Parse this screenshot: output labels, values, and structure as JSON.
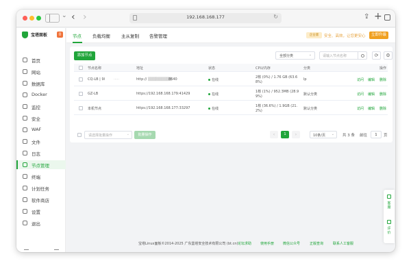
{
  "browser": {
    "url": "192.168.168.177"
  },
  "sidebar": {
    "brand": "宝塔面板",
    "badge": "0",
    "items": [
      {
        "label": "首页",
        "icon": "home-icon"
      },
      {
        "label": "网站",
        "icon": "globe-icon"
      },
      {
        "label": "数据库",
        "icon": "database-icon"
      },
      {
        "label": "Docker",
        "icon": "docker-icon"
      },
      {
        "label": "监控",
        "icon": "monitor-icon"
      },
      {
        "label": "安全",
        "icon": "shield-icon"
      },
      {
        "label": "WAF",
        "icon": "waf-icon"
      },
      {
        "label": "文件",
        "icon": "folder-icon"
      },
      {
        "label": "日志",
        "icon": "log-icon"
      },
      {
        "label": "节点管理",
        "icon": "node-icon"
      },
      {
        "label": "终端",
        "icon": "terminal-icon"
      },
      {
        "label": "计划任务",
        "icon": "calendar-icon"
      },
      {
        "label": "软件商店",
        "icon": "store-icon"
      },
      {
        "label": "设置",
        "icon": "gear-icon"
      },
      {
        "label": "退出",
        "icon": "logout-icon"
      }
    ],
    "active_index": 9
  },
  "topnav": {
    "tabs": [
      "节点",
      "负载均衡",
      "主从复制",
      "告警管理"
    ],
    "active_tab": 0,
    "notice_tag": "企业版",
    "notice_text": "安全、高效，让您更安心",
    "upgrade_label": "立即升级"
  },
  "toolbar": {
    "add_label": "添加节点",
    "category_value": "全部分类",
    "search_placeholder": "请输入节点名称",
    "refresh_icon": "refresh-icon",
    "settings_icon": "gear-icon"
  },
  "table": {
    "headers": [
      "节点名称",
      "地址",
      "状态",
      "CPU/内存",
      "分类",
      "操作"
    ],
    "rows": [
      {
        "name": "CQ-LB | 9l",
        "address": "http://",
        "address_tail": "8640",
        "status": "在线",
        "cpu_mem_1": "2核 (0%) / 1.76 GB (63.6",
        "cpu_mem_2": "8%)",
        "category": "lp",
        "actions": [
          "访问",
          "编辑",
          "删除"
        ]
      },
      {
        "name": "GZ-LB",
        "address": "https://192.168.168.179:41429",
        "address_tail": "",
        "status": "在线",
        "cpu_mem_1": "1核 (1%) / 952.3MB (28.9",
        "cpu_mem_2": "9%)",
        "category": "默认分类",
        "actions": [
          "访问",
          "编辑",
          "删除"
        ]
      },
      {
        "name": "本机节点",
        "address": "https://192.168.168.177:33297",
        "address_tail": "",
        "status": "在线",
        "cpu_mem_1": "1核 (36.6%) / 1.9GB (21.",
        "cpu_mem_2": "2%)",
        "category": "默认分类",
        "actions": [
          "访问",
          "编辑",
          "删除"
        ]
      }
    ]
  },
  "batch": {
    "placeholder": "请选择批量操作",
    "button": "批量操作"
  },
  "pager": {
    "prev": "‹",
    "current": "1",
    "next": "›",
    "page_size": "10条/页",
    "total": "共 3 条",
    "goto_label": "前往",
    "goto_value": "1",
    "page_unit": "页"
  },
  "footer": {
    "copyright": "宝塔Linux面板©2014-2025 广东堡塔安全技术有限公司 (bt.cn)",
    "links": [
      "论坛求助",
      "使用手册",
      "微信公众号",
      "正版查询",
      "联系人工客服"
    ]
  },
  "float_panel": {
    "item1": "客服",
    "item2": "评价"
  }
}
